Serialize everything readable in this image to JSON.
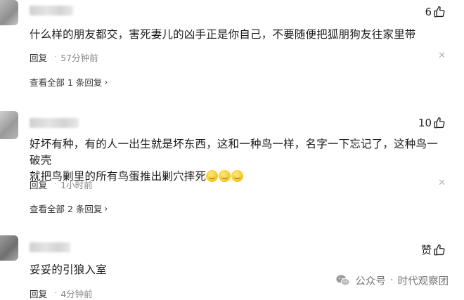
{
  "comments": [
    {
      "likes": "6",
      "text": "什么样的朋友都交，害死妻儿的凶手正是你自己，不要随便把狐朋狗友往家里带",
      "reply_label": "回复",
      "time": "57分钟前",
      "view_all": "查看全部 1 条回复"
    },
    {
      "likes": "10",
      "text_line1": "好坏有种，有的人一出生就是坏东西，这和一种鸟一样，名字一下忘记了，这种鸟一破壳",
      "text_line2": "就把鸟剿里的所有鸟蛋推出剿穴摔死",
      "reply_label": "回复",
      "time": "1小时前",
      "view_all": "查看全部 2 条回复"
    },
    {
      "likes": "赞",
      "text": "妥妥的引狼入室",
      "reply_label": "回复",
      "time": "4分钟前"
    }
  ],
  "separator": "·",
  "close_glyph": "✕",
  "chevron_glyph": "›",
  "watermark": {
    "prefix": "公众号",
    "separator": "·",
    "name": "时代观察团"
  },
  "colors": {
    "background": "#ffffff",
    "meta": "#888888",
    "text": "#1a1a1a"
  }
}
